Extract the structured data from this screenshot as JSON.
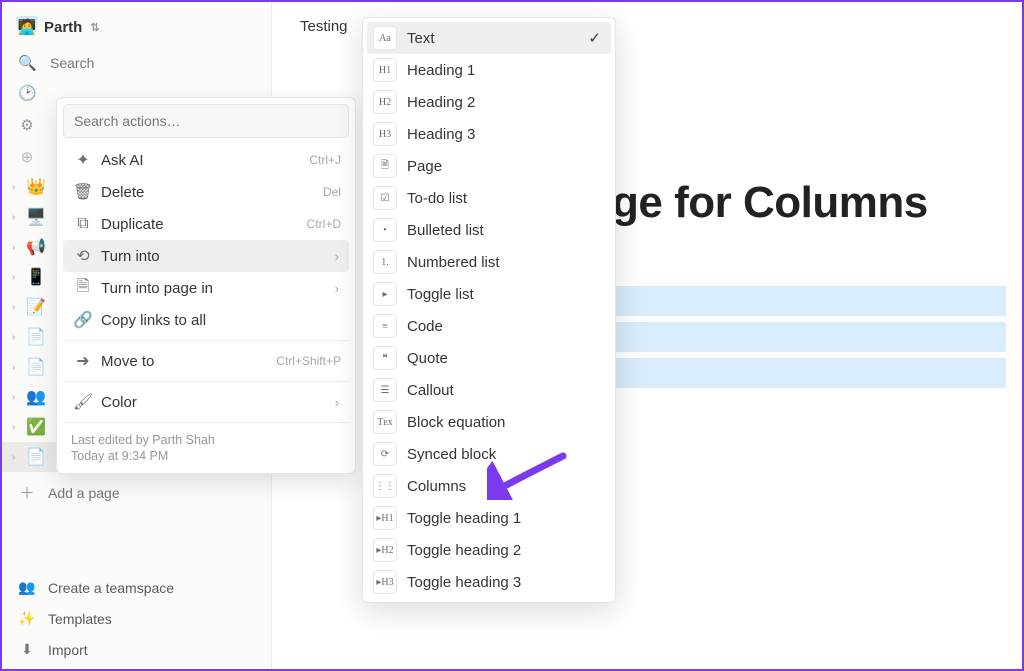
{
  "workspace": {
    "name": "Parth"
  },
  "sidebar": {
    "search_label": "Search",
    "pages": [
      {
        "icon": "👑"
      },
      {
        "icon": "🖥️"
      },
      {
        "icon": "📢"
      },
      {
        "icon": "📱"
      },
      {
        "icon": "📝"
      },
      {
        "icon": "📄"
      },
      {
        "icon": "📄"
      },
      {
        "icon": "👥"
      },
      {
        "icon": "✅"
      },
      {
        "icon": "📄"
      }
    ],
    "add_page": "Add a page",
    "teamspace": "Create a teamspace",
    "templates": "Templates",
    "import": "Import"
  },
  "page": {
    "breadcrumb": "Testing",
    "title_visible": "ge for Columns"
  },
  "context_menu": {
    "search_placeholder": "Search actions…",
    "items": [
      {
        "icon": "✦",
        "label": "Ask AI",
        "shortcut": "Ctrl+J"
      },
      {
        "icon": "🗑",
        "label": "Delete",
        "shortcut": "Del"
      },
      {
        "icon": "⧉",
        "label": "Duplicate",
        "shortcut": "Ctrl+D"
      },
      {
        "icon": "⟲",
        "label": "Turn into",
        "submenu": true,
        "hovered": true
      },
      {
        "icon": "🗎",
        "label": "Turn into page in",
        "submenu": true
      },
      {
        "icon": "🔗",
        "label": "Copy links to all"
      },
      {
        "sep": true
      },
      {
        "icon": "➜",
        "label": "Move to",
        "shortcut": "Ctrl+Shift+P"
      },
      {
        "sep": true
      },
      {
        "icon": "🖌",
        "label": "Color",
        "submenu": true
      }
    ],
    "footer_line1": "Last edited by Parth Shah",
    "footer_line2": "Today at 9:34 PM"
  },
  "turn_into_menu": [
    {
      "thumb": "Aa",
      "label": "Text",
      "checked": true,
      "hovered": true
    },
    {
      "thumb": "H1",
      "label": "Heading 1"
    },
    {
      "thumb": "H2",
      "label": "Heading 2"
    },
    {
      "thumb": "H3",
      "label": "Heading 3"
    },
    {
      "thumb": "🗎",
      "label": "Page"
    },
    {
      "thumb": "☑",
      "label": "To-do list"
    },
    {
      "thumb": "•",
      "label": "Bulleted list"
    },
    {
      "thumb": "1.",
      "label": "Numbered list"
    },
    {
      "thumb": "▸",
      "label": "Toggle list"
    },
    {
      "thumb": "≡",
      "label": "Code"
    },
    {
      "thumb": "❝",
      "label": "Quote"
    },
    {
      "thumb": "☰",
      "label": "Callout"
    },
    {
      "thumb": "Tᴇx",
      "label": "Block equation"
    },
    {
      "thumb": "⟳",
      "label": "Synced block"
    },
    {
      "thumb": "⋮⋮",
      "label": "Columns"
    },
    {
      "thumb": "▸H1",
      "label": "Toggle heading 1"
    },
    {
      "thumb": "▸H2",
      "label": "Toggle heading 2"
    },
    {
      "thumb": "▸H3",
      "label": "Toggle heading 3"
    }
  ]
}
